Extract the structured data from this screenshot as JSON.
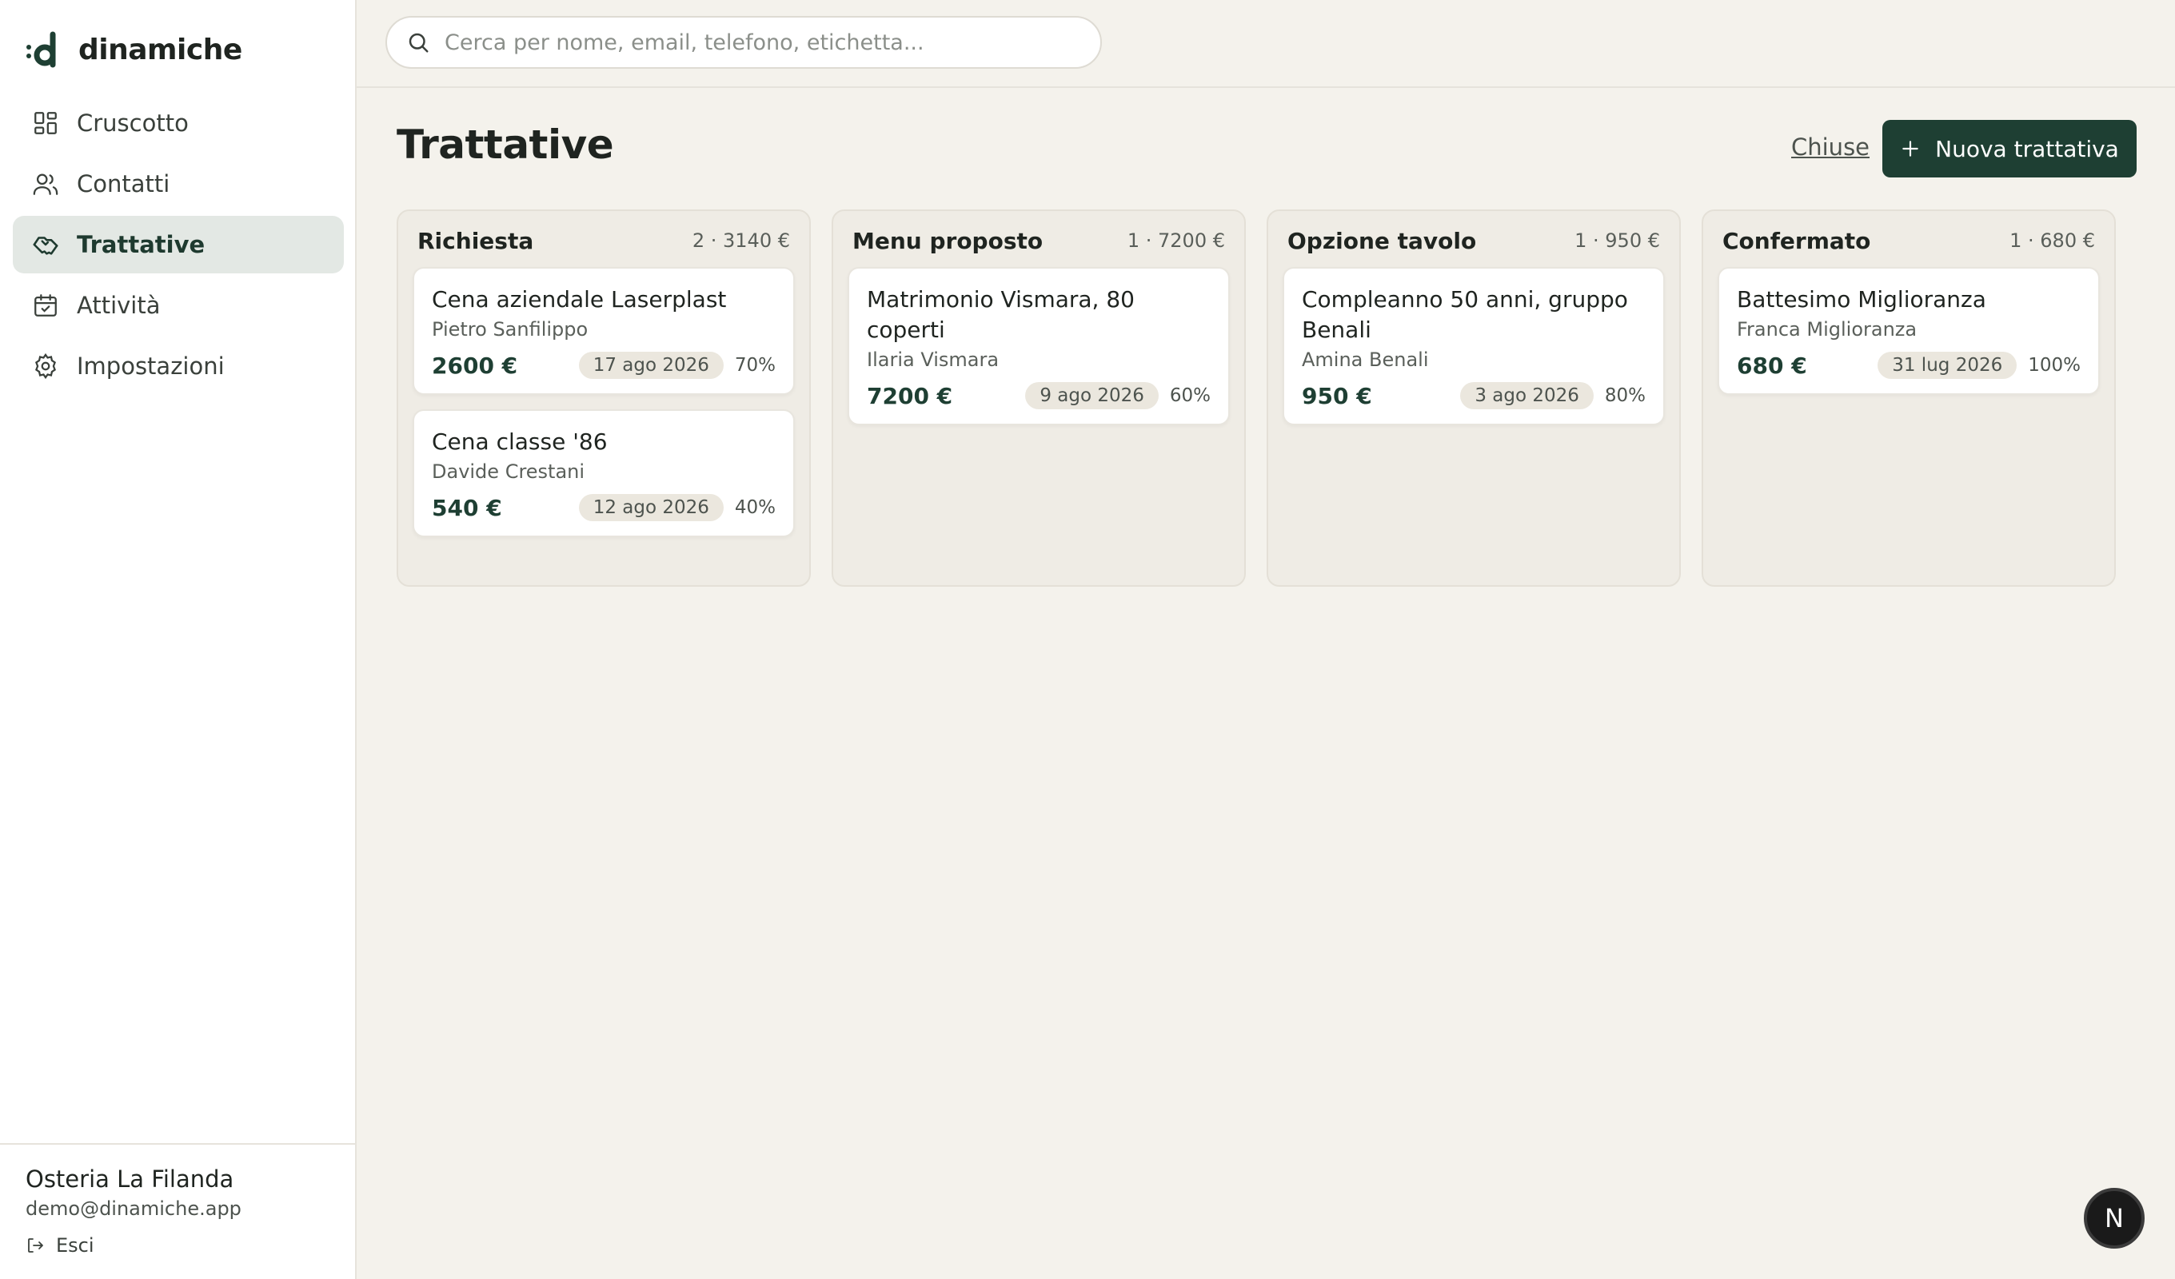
{
  "brand": {
    "name": "dinamiche"
  },
  "nav": {
    "items": [
      {
        "label": "Cruscotto",
        "icon": "dashboard-icon"
      },
      {
        "label": "Contatti",
        "icon": "users-icon"
      },
      {
        "label": "Trattative",
        "icon": "handshake-icon",
        "active": true
      },
      {
        "label": "Attività",
        "icon": "calendar-icon"
      },
      {
        "label": "Impostazioni",
        "icon": "gear-icon"
      }
    ]
  },
  "account": {
    "org": "Osteria La Filanda",
    "email": "demo@dinamiche.app",
    "logout": "Esci"
  },
  "search": {
    "placeholder": "Cerca per nome, email, telefono, etichetta..."
  },
  "page": {
    "title": "Trattative",
    "closed_link": "Chiuse",
    "new_button": "Nuova trattativa"
  },
  "columns": [
    {
      "title": "Richiesta",
      "meta": "2 · 3140 €",
      "cards": [
        {
          "title": "Cena aziendale Laserplast",
          "contact": "Pietro Sanfilippo",
          "amount": "2600 €",
          "date": "17 ago 2026",
          "probability": "70%"
        },
        {
          "title": "Cena classe '86",
          "contact": "Davide Crestani",
          "amount": "540 €",
          "date": "12 ago 2026",
          "probability": "40%"
        }
      ]
    },
    {
      "title": "Menu proposto",
      "meta": "1 · 7200 €",
      "cards": [
        {
          "title": "Matrimonio Vismara, 80 coperti",
          "contact": "Ilaria Vismara",
          "amount": "7200 €",
          "date": "9 ago 2026",
          "probability": "60%"
        }
      ]
    },
    {
      "title": "Opzione tavolo",
      "meta": "1 · 950 €",
      "cards": [
        {
          "title": "Compleanno 50 anni, gruppo Benali",
          "contact": "Amina Benali",
          "amount": "950 €",
          "date": "3 ago 2026",
          "probability": "80%"
        }
      ]
    },
    {
      "title": "Confermato",
      "meta": "1 · 680 €",
      "cards": [
        {
          "title": "Battesimo Miglioranza",
          "contact": "Franca Miglioranza",
          "amount": "680 €",
          "date": "31 lug 2026",
          "probability": "100%"
        }
      ]
    }
  ],
  "fab": {
    "label": "N"
  },
  "colors": {
    "accent": "#1e3f33",
    "background": "#f4f2ec",
    "active_nav": "#e3e8e4"
  }
}
